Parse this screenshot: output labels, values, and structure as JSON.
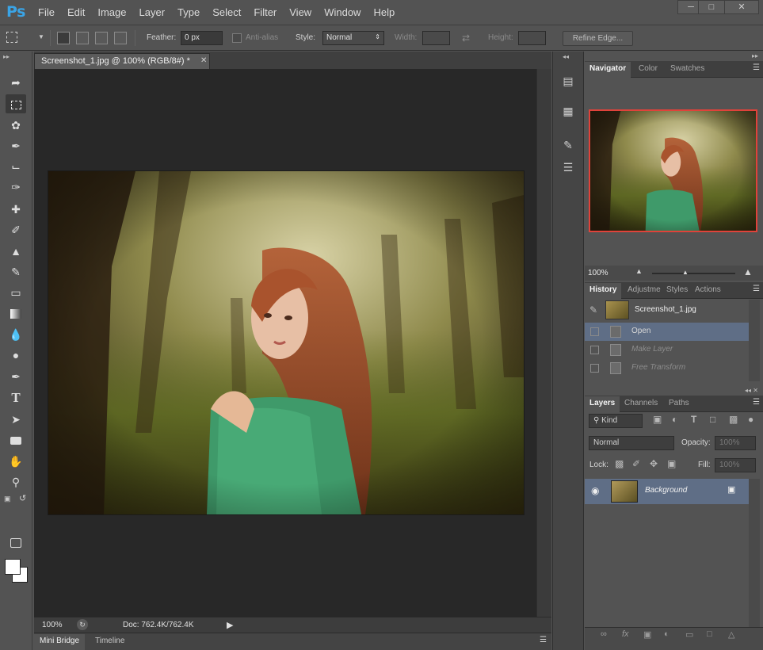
{
  "app": {
    "logo": "Ps"
  },
  "menu": [
    "File",
    "Edit",
    "Image",
    "Layer",
    "Type",
    "Select",
    "Filter",
    "View",
    "Window",
    "Help"
  ],
  "window_controls": [
    "minimize-icon",
    "maximize-icon",
    "close-icon"
  ],
  "options": {
    "feather_label": "Feather:",
    "feather_value": "0 px",
    "antialias_label": "Anti-alias",
    "style_label": "Style:",
    "style_value": "Normal",
    "width_label": "Width:",
    "height_label": "Height:",
    "refine_edge": "Refine Edge..."
  },
  "tools": [
    "move-icon",
    "marquee-icon",
    "lasso-icon",
    "quick-selection-icon",
    "crop-icon",
    "eyedropper-icon",
    "healing-brush-icon",
    "brush-icon",
    "clone-stamp-icon",
    "history-brush-icon",
    "eraser-icon",
    "gradient-icon",
    "blur-icon",
    "dodge-icon",
    "pen-icon",
    "type-icon",
    "path-selection-icon",
    "rectangle-shape-icon",
    "hand-icon",
    "zoom-icon"
  ],
  "colors": {
    "foreground": "#ffffff",
    "background": "#ffffff",
    "accent": "#3aa4e6",
    "navigator_box": "#e0423a",
    "selection": "#5f6e86"
  },
  "document": {
    "tab_title": "Screenshot_1.jpg @ 100% (RGB/8#) *",
    "zoom": "100%",
    "doc_size": "Doc: 762.4K/762.4K"
  },
  "bottom_tabs": [
    "Mini Bridge",
    "Timeline"
  ],
  "navigator": {
    "tabs": [
      "Navigator",
      "Color",
      "Swatches"
    ],
    "zoom": "100%"
  },
  "history": {
    "tabs": [
      "History",
      "Adjustme",
      "Styles",
      "Actions"
    ],
    "snapshot": "Screenshot_1.jpg",
    "steps": [
      "Open",
      "Make Layer",
      "Free Transform"
    ]
  },
  "layers": {
    "tabs": [
      "Layers",
      "Channels",
      "Paths"
    ],
    "filter_kind": "Kind",
    "blend_mode": "Normal",
    "opacity_label": "Opacity:",
    "opacity_value": "100%",
    "lock_label": "Lock:",
    "fill_label": "Fill:",
    "fill_value": "100%",
    "layer_name": "Background"
  }
}
